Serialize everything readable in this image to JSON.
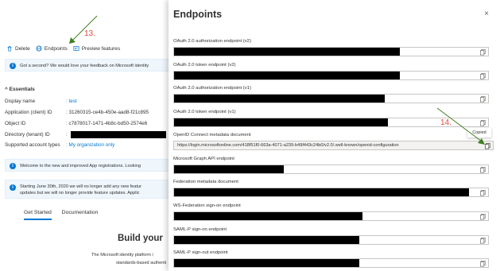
{
  "toolbar": {
    "delete_label": "Delete",
    "endpoints_label": "Endpoints",
    "preview_label": "Preview features"
  },
  "feedback_banner": "Got a second? We would love your feedback on Microsoft identity",
  "annotations": {
    "step_13": "13.",
    "step_14": "14."
  },
  "essentials": {
    "title": "Essentials",
    "rows": [
      {
        "key": "Display name",
        "value": ": test"
      },
      {
        "key": "Application (client) ID",
        "value": ": 31260315-ce4b-450e-aad8-f21c895"
      },
      {
        "key": "Object ID",
        "value": ": c7878017-1471-4b8c-bd50-2574e6"
      },
      {
        "key": "Directory (tenant) ID",
        "value": ":"
      },
      {
        "key": "Supported account types",
        "value": ": My organization only"
      }
    ]
  },
  "welcome_banner": "Welcome to the new and improved App registrations. Looking",
  "notice_banner": {
    "line1": "Starting June 30th, 2020 we will no longer add any new featur",
    "line2": "updates but we will no longer provide feature updates. Applic"
  },
  "tabs": [
    "Get Started",
    "Documentation"
  ],
  "build": {
    "title": "Build your",
    "line1": "The Microsoft identity platform i",
    "line2": "standards-based authenti"
  },
  "panel": {
    "title": "Endpoints",
    "close_glyph": "×",
    "copied_tooltip": "Copied",
    "endpoints": [
      {
        "label": "OAuth 2.0 authorization endpoint (v2)",
        "text": "",
        "redacted_fraction": 0.72
      },
      {
        "label": "OAuth 2.0 token endpoint (v2)",
        "text": "",
        "redacted_fraction": 0.72
      },
      {
        "label": "OAuth 2.0 authorization endpoint (v1)",
        "text": "",
        "redacted_fraction": 0.67
      },
      {
        "label": "OAuth 2.0 token endpoint (v1)",
        "text": "",
        "redacted_fraction": 0.68
      },
      {
        "label": "OpenID Connect metadata document",
        "text": "https://login.microsoftonline.com/418f51f0-663a-4071-a239-b49f443c24b0/v2.0/.well-known/openid-configuration",
        "redacted_fraction": 0
      },
      {
        "label": "Microsoft Graph API endpoint",
        "text": "",
        "redacted_fraction": 0.35
      },
      {
        "label": "Federation metadata document",
        "text": "",
        "redacted_fraction": 0.94
      },
      {
        "label": "WS-Federation sign-on endpoint",
        "text": "",
        "redacted_fraction": 0.6
      },
      {
        "label": "SAML-P sign-on endpoint",
        "text": "",
        "redacted_fraction": 0.59
      },
      {
        "label": "SAML-P sign-out endpoint",
        "text": "",
        "redacted_fraction": 0.59
      }
    ]
  },
  "colors": {
    "accent": "#0078d4",
    "annotation": "#e8473b",
    "arrow": "#3f7f1f",
    "redaction": "#000000"
  }
}
